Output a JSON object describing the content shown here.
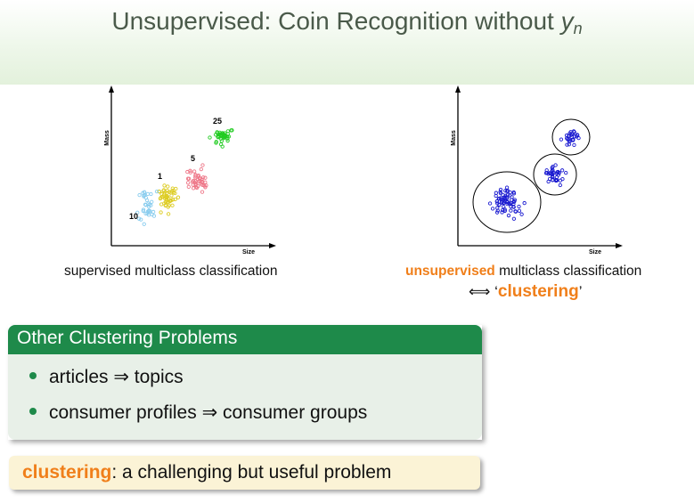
{
  "title": {
    "text": "Unsupervised: Coin Recognition without ",
    "var": "y",
    "sub": "n"
  },
  "left_plot": {
    "ylabel": "Mass",
    "xlabel": "Size",
    "labels": [
      "25",
      "5",
      "1",
      "10"
    ],
    "colors": {
      "c25": "#22cc22",
      "c5": "#ee7788",
      "c1": "#ddcc22",
      "c10": "#88ccee"
    },
    "caption": "supervised multiclass classification"
  },
  "right_plot": {
    "ylabel": "Mass",
    "xlabel": "Size",
    "point_color": "#1a1ad0",
    "caption_em": "unsupervised",
    "caption_rest": " multiclass classification",
    "equiv": "⟺ ‘",
    "equiv_word": "clustering",
    "equiv_close": "’"
  },
  "block": {
    "heading": "Other Clustering Problems",
    "items": [
      "articles ⇒ topics",
      "consumer profiles ⇒ consumer groups"
    ]
  },
  "note": {
    "em": "clustering",
    "rest": ": a challenging but useful problem"
  }
}
